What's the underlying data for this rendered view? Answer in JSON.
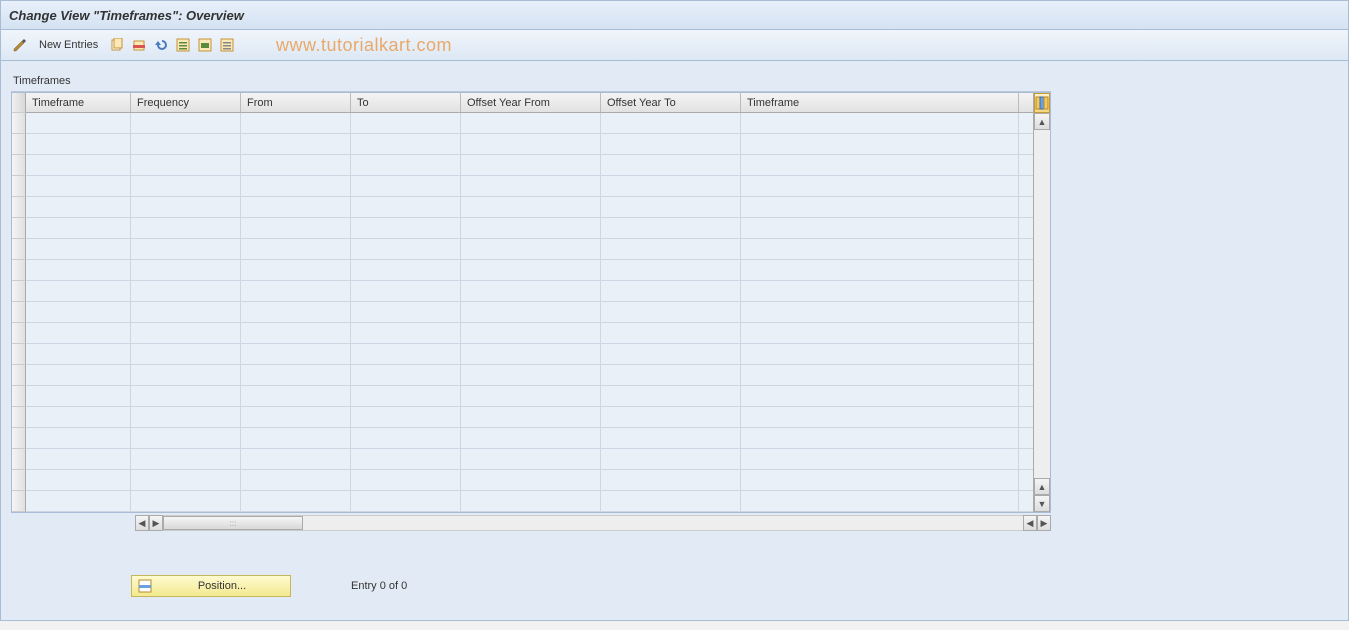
{
  "header": {
    "title": "Change View \"Timeframes\": Overview"
  },
  "toolbar": {
    "new_entries_label": "New Entries",
    "watermark": "www.tutorialkart.com"
  },
  "group": {
    "title": "Timeframes"
  },
  "table": {
    "columns": {
      "timeframe1": "Timeframe",
      "frequency": "Frequency",
      "from": "From",
      "to": "To",
      "offset_year_from": "Offset Year From",
      "offset_year_to": "Offset Year To",
      "timeframe2": "Timeframe"
    },
    "row_count": 19
  },
  "footer": {
    "position_label": "Position...",
    "entry_text": "Entry 0 of 0"
  }
}
